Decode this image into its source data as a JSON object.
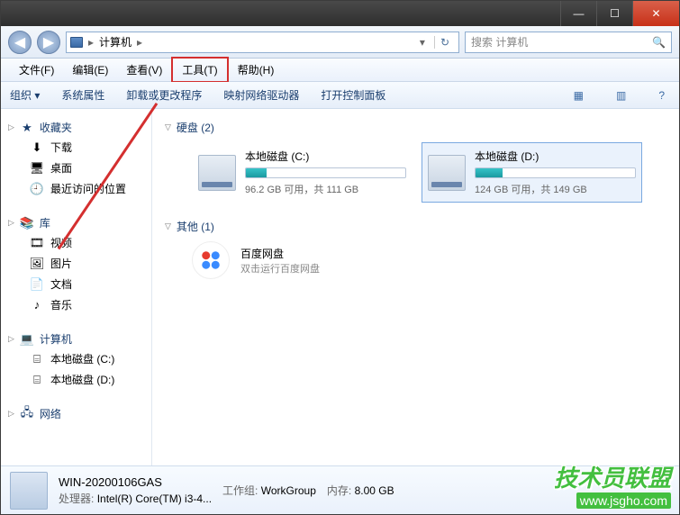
{
  "titlebar": {
    "min": "—",
    "max": "☐",
    "close": "✕"
  },
  "nav": {
    "back": "◀",
    "fwd": "▶",
    "path_seg1": "计算机",
    "path_sep": "▸",
    "dd": "▾",
    "refresh": "↻",
    "search_placeholder": "搜索 计算机",
    "search_icon": "🔍"
  },
  "menubar": {
    "file": "文件(F)",
    "edit": "编辑(E)",
    "view": "查看(V)",
    "tools": "工具(T)",
    "help": "帮助(H)"
  },
  "toolbar": {
    "org": "组织 ▾",
    "sysprops": "系统属性",
    "uninstall": "卸载或更改程序",
    "mapdrv": "映射网络驱动器",
    "ctrlpanel": "打开控制面板",
    "view_icon": "▦",
    "layout_icon": "▥",
    "help_icon": "?"
  },
  "sidebar": {
    "fav": "收藏夹",
    "fav_items": [
      {
        "icon": "⬇",
        "label": "下载"
      },
      {
        "icon": "🖥",
        "label": "桌面"
      },
      {
        "icon": "🕘",
        "label": "最近访问的位置"
      }
    ],
    "lib": "库",
    "lib_items": [
      {
        "icon": "🎞",
        "label": "视频"
      },
      {
        "icon": "🖼",
        "label": "图片"
      },
      {
        "icon": "📄",
        "label": "文档"
      },
      {
        "icon": "♪",
        "label": "音乐"
      }
    ],
    "computer": "计算机",
    "comp_items": [
      {
        "icon": "⌸",
        "label": "本地磁盘 (C:)"
      },
      {
        "icon": "⌸",
        "label": "本地磁盘 (D:)"
      }
    ],
    "network": "网络"
  },
  "content": {
    "hd_header": "硬盘 (2)",
    "drives": [
      {
        "name": "本地磁盘 (C:)",
        "stat": "96.2 GB 可用，共 111 GB",
        "pct": 13
      },
      {
        "name": "本地磁盘 (D:)",
        "stat": "124 GB 可用，共 149 GB",
        "pct": 17
      }
    ],
    "other_header": "其他 (1)",
    "other": {
      "name": "百度网盘",
      "sub": "双击运行百度网盘"
    }
  },
  "status": {
    "name": "WIN-20200106GAS",
    "wg_label": "工作组:",
    "wg": "WorkGroup",
    "mem_label": "内存:",
    "mem": "8.00 GB",
    "cpu_label": "处理器:",
    "cpu": "Intel(R) Core(TM) i3-4..."
  },
  "watermark": {
    "line1": "技术员联盟",
    "line2": "www.jsgho.com"
  }
}
